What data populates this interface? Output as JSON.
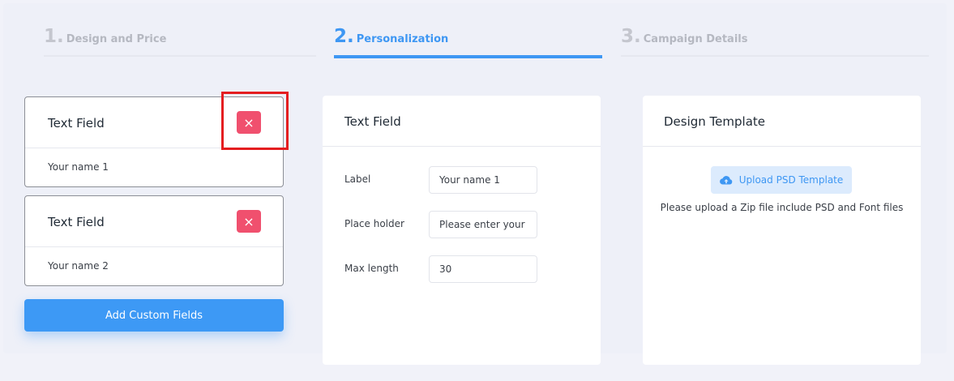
{
  "steps": [
    {
      "number": "1.",
      "label": "Design and Price"
    },
    {
      "number": "2.",
      "label": "Personalization"
    },
    {
      "number": "3.",
      "label": "Campaign Details"
    }
  ],
  "fields": [
    {
      "title": "Text Field",
      "value": "Your name 1",
      "delete_icon": "×"
    },
    {
      "title": "Text Field",
      "value": "Your name 2",
      "delete_icon": "×"
    }
  ],
  "add_button_label": "Add Custom Fields",
  "editor": {
    "title": "Text Field",
    "label_caption": "Label",
    "label_value": "Your name 1",
    "placeholder_caption": "Place holder",
    "placeholder_value": "Please enter your name",
    "maxlength_caption": "Max length",
    "maxlength_value": "30"
  },
  "template": {
    "title": "Design Template",
    "upload_label": "Upload PSD Template",
    "upload_icon": "cloud-upload-icon",
    "note": "Please upload a Zip file include PSD and Font files"
  },
  "colors": {
    "accent": "#3e97f3",
    "danger": "#f0506e",
    "highlight": "#e41e20"
  }
}
